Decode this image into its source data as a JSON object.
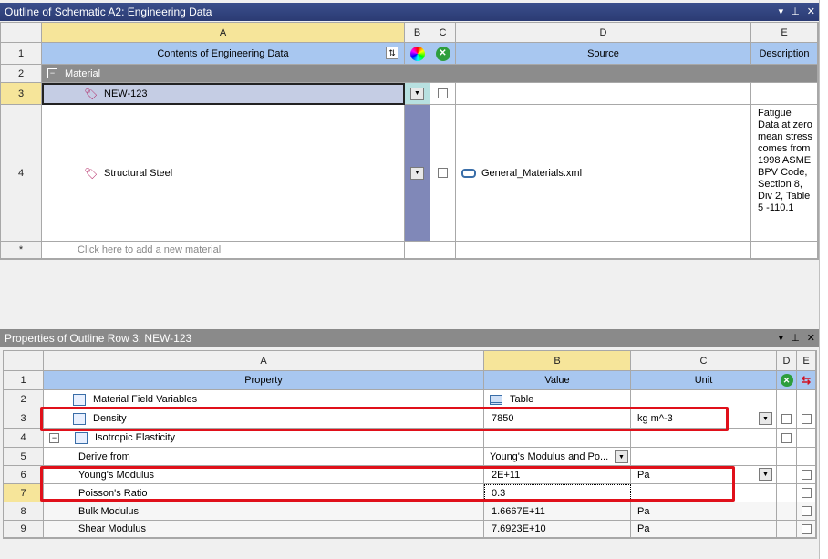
{
  "outline": {
    "title": "Outline of Schematic A2: Engineering Data",
    "window_ctrls": [
      "▾",
      "⊥",
      "✕"
    ],
    "col_letters": [
      "A",
      "B",
      "C",
      "D",
      "E"
    ],
    "header_row": {
      "num": "1",
      "contents": "Contents of Engineering Data",
      "source": "Source",
      "description": "Description"
    },
    "rows": [
      {
        "num": "2",
        "label": "Material"
      },
      {
        "num": "3",
        "name": "NEW-123",
        "source": ""
      },
      {
        "num": "4",
        "name": "Structural Steel",
        "source": "General_Materials.xml",
        "description": "Fatigue Data at zero mean stress comes from 1998 ASME BPV Code, Section 8, Div 2, Table 5 -110.1"
      },
      {
        "num": "*",
        "placeholder": "Click here to add a new material"
      }
    ]
  },
  "properties": {
    "title": "Properties of Outline Row 3: NEW-123",
    "window_ctrls": [
      "▾",
      "⊥",
      "✕"
    ],
    "col_letters": [
      "A",
      "B",
      "C",
      "D",
      "E"
    ],
    "header_row": {
      "num": "1",
      "property": "Property",
      "value": "Value",
      "unit": "Unit"
    },
    "rows": [
      {
        "num": "2",
        "property": "Material Field Variables",
        "value": "Table",
        "unit": ""
      },
      {
        "num": "3",
        "property": "Density",
        "value": "7850",
        "unit": "kg m^-3"
      },
      {
        "num": "4",
        "property": "Isotropic Elasticity",
        "value": "",
        "unit": ""
      },
      {
        "num": "5",
        "property": "Derive from",
        "value": "Young's Modulus and Po...",
        "unit": ""
      },
      {
        "num": "6",
        "property": "Young's Modulus",
        "value": "2E+11",
        "unit": "Pa"
      },
      {
        "num": "7",
        "property": "Poisson's Ratio",
        "value": "0.3",
        "unit": ""
      },
      {
        "num": "8",
        "property": "Bulk Modulus",
        "value": "1.6667E+11",
        "unit": "Pa"
      },
      {
        "num": "9",
        "property": "Shear Modulus",
        "value": "7.6923E+10",
        "unit": "Pa"
      }
    ]
  },
  "colors": {
    "header_blue": "#a8c7f0",
    "selected_yellow": "#f6e59a",
    "highlight_red": "#e0101a",
    "title_blue": "#2b3b73"
  }
}
